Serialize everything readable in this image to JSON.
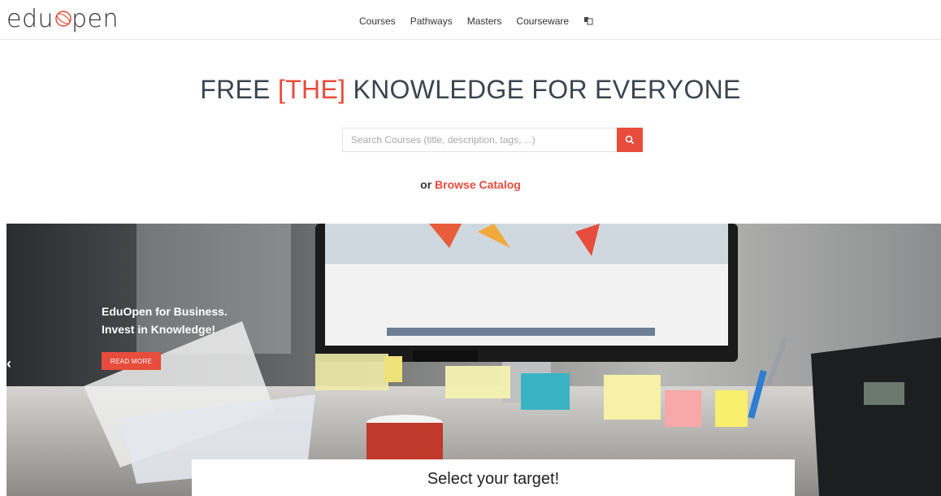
{
  "logo": {
    "text_left": "edu",
    "text_right": "pen"
  },
  "nav": {
    "items": [
      "Courses",
      "Pathways",
      "Masters",
      "Courseware"
    ]
  },
  "hero": {
    "title_before": "FREE ",
    "title_bracket": "[THE]",
    "title_after": " KNOWLEDGE FOR EVERYONE",
    "search_placeholder": "Search Courses (title, description, tags, ...)",
    "browse_prefix": "or ",
    "browse_link": "Browse Catalog"
  },
  "banner": {
    "title_line1": "EduOpen for Business.",
    "title_line2": "Invest in Knowledge!",
    "cta": "READ MORE",
    "prev_arrow": "‹",
    "target_title": "Select your target!"
  },
  "colors": {
    "accent": "#e74c3c",
    "text": "#333333"
  }
}
